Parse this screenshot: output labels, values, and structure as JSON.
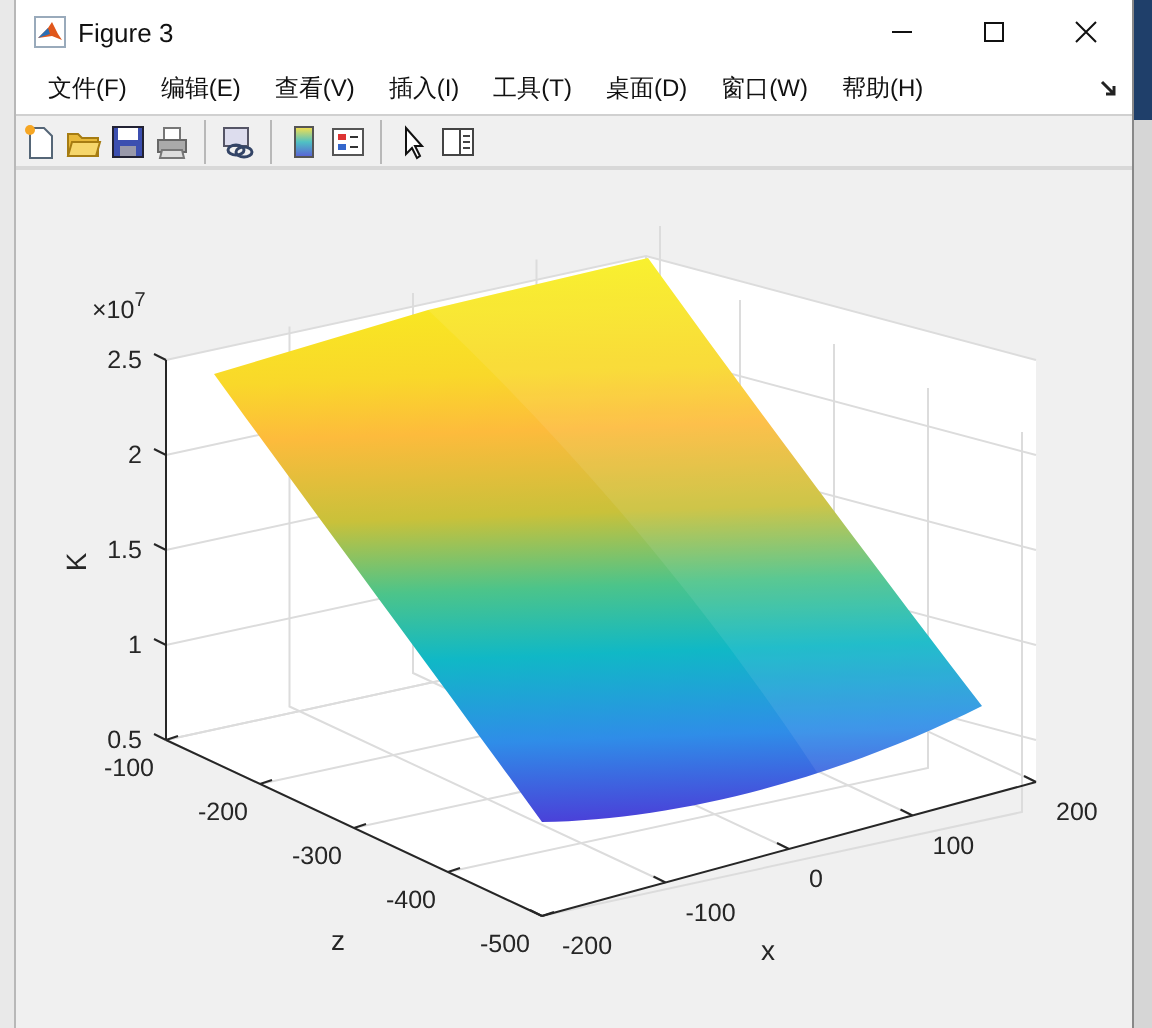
{
  "window": {
    "title": "Figure 3"
  },
  "menu": [
    "文件(F)",
    "编辑(E)",
    "查看(V)",
    "插入(I)",
    "工具(T)",
    "桌面(D)",
    "窗口(W)",
    "帮助(H)"
  ],
  "plot": {
    "exponent_base": "×10",
    "exponent": "7",
    "zlabel": "K",
    "xlabel": "x",
    "ylabel": "z",
    "k_ticks": [
      "2.5",
      "2",
      "1.5",
      "1",
      "0.5"
    ],
    "z_ticks": [
      "-100",
      "-200",
      "-300",
      "-400",
      "-500"
    ],
    "x_ticks": [
      "-200",
      "-100",
      "0",
      "100",
      "200"
    ]
  }
}
